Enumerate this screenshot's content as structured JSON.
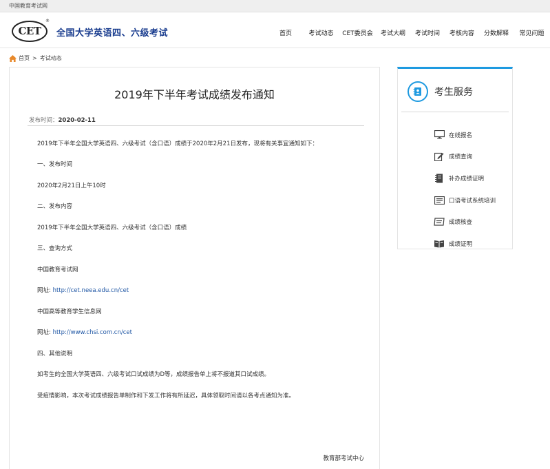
{
  "topbar": {
    "site_name": "中国教育考试网"
  },
  "header": {
    "logo_text": "CET",
    "logo_mark": "®",
    "site_title": "全国大学英语四、六级考试"
  },
  "nav": [
    {
      "label": "首页",
      "active": false
    },
    {
      "label": "考试动态",
      "active": true
    },
    {
      "label": "CET委员会",
      "active": false
    },
    {
      "label": "考试大纲",
      "active": false
    },
    {
      "label": "考试时间",
      "active": false
    },
    {
      "label": "考核内容",
      "active": false
    },
    {
      "label": "分数解释",
      "active": false
    },
    {
      "label": "常见问题",
      "active": false
    }
  ],
  "breadcrumb": {
    "home": "首页",
    "separator": ">",
    "current": "考试动态",
    "icon": "home-icon"
  },
  "article": {
    "title": "2019年下半年考试成绩发布通知",
    "date_label": "发布时间：",
    "date": "2020-02-11",
    "paragraphs": [
      {
        "text": "2019年下半年全国大学英语四、六级考试（含口语）成绩于2020年2月21日发布，现将有关事宜通知如下："
      },
      {
        "text": "一、发布时间"
      },
      {
        "text": "2020年2月21日上午10时"
      },
      {
        "text": "二、发布内容"
      },
      {
        "text": "2019年下半年全国大学英语四、六级考试（含口语）成绩"
      },
      {
        "text": "三、查询方式"
      },
      {
        "text": "中国教育考试网"
      },
      {
        "prefix": "网址: ",
        "link": "http://cet.neea.edu.cn/cet"
      },
      {
        "text": "中国高等教育学生信息网"
      },
      {
        "prefix": "网址: ",
        "link": "http://www.chsi.com.cn/cet"
      },
      {
        "text": "四、其他说明"
      },
      {
        "text": "如考生的全国大学英语四、六级考试口试成绩为D等，成绩报告单上将不报道其口试成绩。"
      },
      {
        "text": "受疫情影响，本次考试成绩报告单制作和下发工作将有所延迟，具体领取时间请以各考点通知为准。"
      }
    ],
    "signature": "教育部考试中心"
  },
  "service": {
    "title": "考生服务",
    "icon": "address-book-icon",
    "links": [
      {
        "label": "在线报名",
        "icon": "monitor-icon"
      },
      {
        "label": "成绩查询",
        "icon": "edit-icon"
      },
      {
        "label": "补办成绩证明",
        "icon": "document-icon"
      },
      {
        "label": "口语考试系统培训",
        "icon": "screen-icon"
      },
      {
        "label": "成绩核查",
        "icon": "ticket-icon"
      },
      {
        "label": "成绩证明",
        "icon": "book-icon"
      }
    ]
  },
  "colors": {
    "accent": "#1e88e5",
    "title_blue": "#1a3d8f",
    "link": "#1c54a3",
    "side_accent": "#1e9ae0"
  }
}
